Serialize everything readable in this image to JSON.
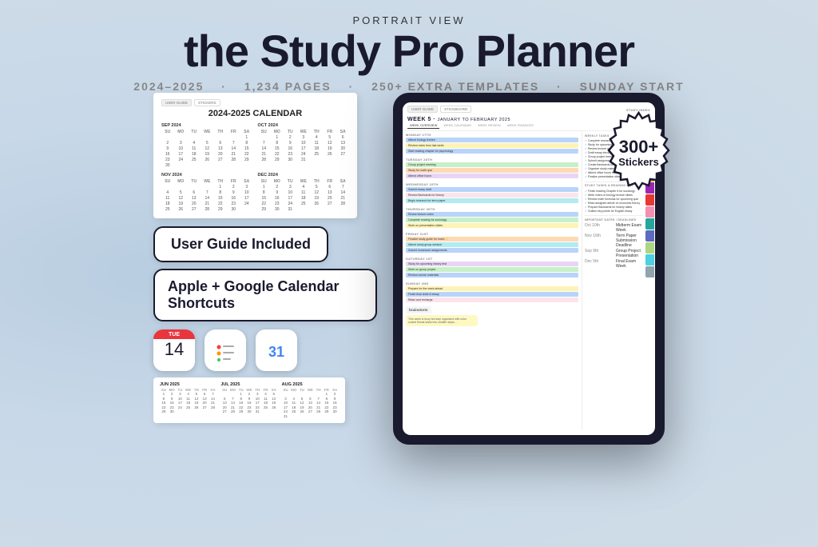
{
  "header": {
    "portrait_view": "PORTRAIT VIEW",
    "main_title": "the Study Pro Planner",
    "tagline_parts": [
      "2024–2025",
      "1,234 PAGES",
      "250+ EXTRA TEMPLATES",
      "SUNDAY START"
    ]
  },
  "left": {
    "calendar_title": "2024-2025 CALENDAR",
    "user_guide_label": "User Guide Included",
    "calendar_shortcuts_label": "Apple + Google Calendar Shortcuts",
    "apple_cal_day": "TUE",
    "apple_cal_date": "14"
  },
  "stickers_badge": {
    "number": "300+",
    "label": "Stickers"
  },
  "tablet": {
    "week_label": "WEEK 5",
    "date_range": "JANUARY TO FEBRUARY 2025",
    "week_title": "WEEK 5 · JANUARY TO FEBRUARY 2025",
    "nav_tabs": [
      "WEEK OVERVIEW",
      "WEEK CALENDAR",
      "WEEK REVIEW",
      "WEEK FINANCES"
    ],
    "days": [
      {
        "label": "MONDAY 27TH",
        "tasks": [
          {
            "text": "Attend biology lecture",
            "color": "task-blue"
          },
          {
            "text": "Review notes from last week",
            "color": "task-yellow"
          },
          {
            "text": "Start reading chapter for psychology",
            "color": "task-blue"
          }
        ]
      },
      {
        "label": "TUESDAY 28TH",
        "tasks": [
          {
            "text": "Group project meeting",
            "color": "task-green"
          },
          {
            "text": "Study for math quiz",
            "color": "task-orange"
          },
          {
            "text": "Attend office hours",
            "color": "task-purple"
          }
        ]
      },
      {
        "label": "WEDNESDAY 29TH",
        "tasks": [
          {
            "text": "Submit essay draft",
            "color": "task-blue"
          },
          {
            "text": "Review flashcards for history",
            "color": "task-pink"
          },
          {
            "text": "Begin research for term paper",
            "color": "task-teal"
          }
        ]
      },
      {
        "label": "THURSDAY 30TH",
        "tasks": [
          {
            "text": "Revise lecture notes",
            "color": "task-blue"
          },
          {
            "text": "Complete reading for sociology",
            "color": "task-green"
          },
          {
            "text": "Work on presentation slides",
            "color": "task-yellow"
          }
        ]
      },
      {
        "label": "FRIDAY 31ST",
        "tasks": [
          {
            "text": "Finalize study guide for exam",
            "color": "task-orange"
          },
          {
            "text": "Attend study group session",
            "color": "task-teal"
          },
          {
            "text": "Submit homework assignments",
            "color": "task-blue"
          }
        ]
      },
      {
        "label": "SATURDAY 1ST",
        "tasks": [
          {
            "text": "Study for upcoming history test",
            "color": "task-purple"
          },
          {
            "text": "Work on group project",
            "color": "task-green"
          },
          {
            "text": "Review course materials",
            "color": "task-blue"
          }
        ]
      },
      {
        "label": "SUNDAY 2ND",
        "tasks": [
          {
            "text": "Prepare for the week ahead",
            "color": "task-yellow"
          },
          {
            "text": "Finish final draft of essay",
            "color": "task-blue"
          },
          {
            "text": "Relax and recharge",
            "color": "task-pink"
          }
        ]
      }
    ],
    "weekly_tasks_title": "WEEKLY TASKS",
    "weekly_tasks": [
      "Complete research for term paper",
      "Study for upcoming math exam",
      "Review lecture notes from the week",
      "Draft essay introduction for English class",
      "Group project meeting for biology",
      "Submit assignments for sociology",
      "Create flashcards for history revision",
      "Organize study materials and readings",
      "Attend office hours for extra help",
      "Finalize presentation slides for class"
    ],
    "study_tasks_title": "STUDY TASKS & READING LIST",
    "study_tasks": [
      "Finish reading Chapter 6 for sociology",
      "Write notes on biology lecture slides",
      "Review math formulas for upcoming quiz",
      "Read assigned article on economic theory",
      "Prepare flashcards for history dates",
      "Outline key points for English essay"
    ],
    "important_dates_title": "IMPORTANT DATES / DEADLINES",
    "important_dates": [
      {
        "date": "Oct 10th",
        "event": "Midterm Exam Week"
      },
      {
        "date": "Nov 16th",
        "event": "Term Paper Submission Deadline"
      },
      {
        "date": "Sep 9th",
        "event": "Group Project Presentation"
      },
      {
        "date": "Dec 5th",
        "event": "Final Exam Week"
      }
    ]
  },
  "months": {
    "sep2024": "SEP 2024",
    "oct2024": "OCT 2024",
    "nov": "NOV",
    "jun2025": "JUN 2025",
    "jul2025": "JUL 2025"
  }
}
